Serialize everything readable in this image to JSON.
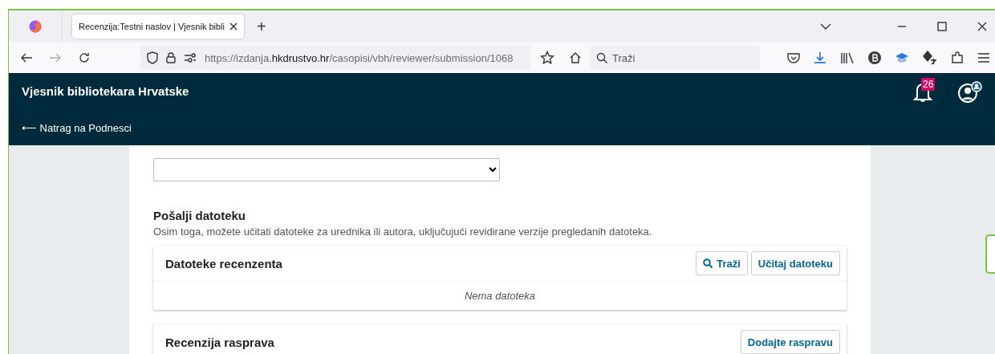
{
  "browser": {
    "tabs": [
      {
        "title": "Recenzija:Testni naslov | Vjesnik bibli",
        "selected": true
      }
    ],
    "new_tab": "+",
    "url": "https://izdanja.**hkdrustvo.hr**/casopisi/vbh/reviewer/submission/1068",
    "search": {
      "placeholder": "Traži"
    }
  },
  "header": {
    "title": "Vjesnik bibliotekara Hrvatske",
    "back_link": "⟵ Natrag na Podnesci",
    "notifications": "26"
  },
  "content": {
    "upload": {
      "heading": "Pošalji datoteku",
      "description": "Osim toga, možete učitati datoteke za urednika ili autora, uključujući revidirane verzije pregledanih datoteka."
    },
    "files_panel": {
      "title": "Datoteke recenzenta",
      "buttons": [
        {
          "label": "Traži",
          "kind": "search"
        },
        {
          "label": "Učitaj datoteku",
          "kind": "plain"
        }
      ],
      "empty": "Nema datoteka"
    },
    "discussions_panel": {
      "title": "Recenzija rasprava",
      "buttons": [
        {
          "label": "Dodajte raspravu",
          "kind": "plain"
        }
      ]
    }
  }
}
